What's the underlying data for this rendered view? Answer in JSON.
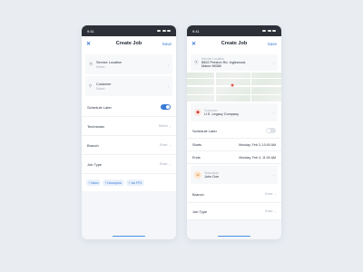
{
  "left": {
    "status_time": "9:41",
    "nav": {
      "close": "✕",
      "title": "Create Job",
      "save": "Save"
    },
    "service": {
      "label": "Service Location",
      "value": "Select"
    },
    "customer": {
      "label": "Customer",
      "value": "Select"
    },
    "schedule_later": {
      "label": "Schedule Later",
      "on": true
    },
    "technician": {
      "label": "Technician",
      "value": "Select"
    },
    "branch": {
      "label": "Branch",
      "value": "Enter"
    },
    "job_type": {
      "label": "Job Type",
      "value": "Enter"
    },
    "chips": [
      "+ Notes",
      "+ Description",
      "+ Job PFS"
    ]
  },
  "right": {
    "status_time": "9:41",
    "nav": {
      "close": "✕",
      "title": "Create Job",
      "save": "Save"
    },
    "service": {
      "label": "Service Location",
      "line1": "8502 Preston Rd. Inglewood,",
      "line2": "Maine 98380"
    },
    "customer": {
      "label": "Customer",
      "value": "U.S. Legacy Company"
    },
    "schedule_later": {
      "label": "Schedule Later",
      "on": false
    },
    "starts": {
      "label": "Starts",
      "value": "Monday, Feb 3, 10:00 AM"
    },
    "ends": {
      "label": "Ends",
      "value": "Monday, Feb 3, 11:00 AM"
    },
    "technician": {
      "label": "Technician",
      "value": "John Doe"
    },
    "branch": {
      "label": "Branch",
      "value": "Enter"
    },
    "job_type": {
      "label": "Job Type",
      "value": "Enter"
    }
  },
  "colors": {
    "accent": "#3a7bd5",
    "statusbar": "#2d3038",
    "background": "#e9edf2"
  }
}
